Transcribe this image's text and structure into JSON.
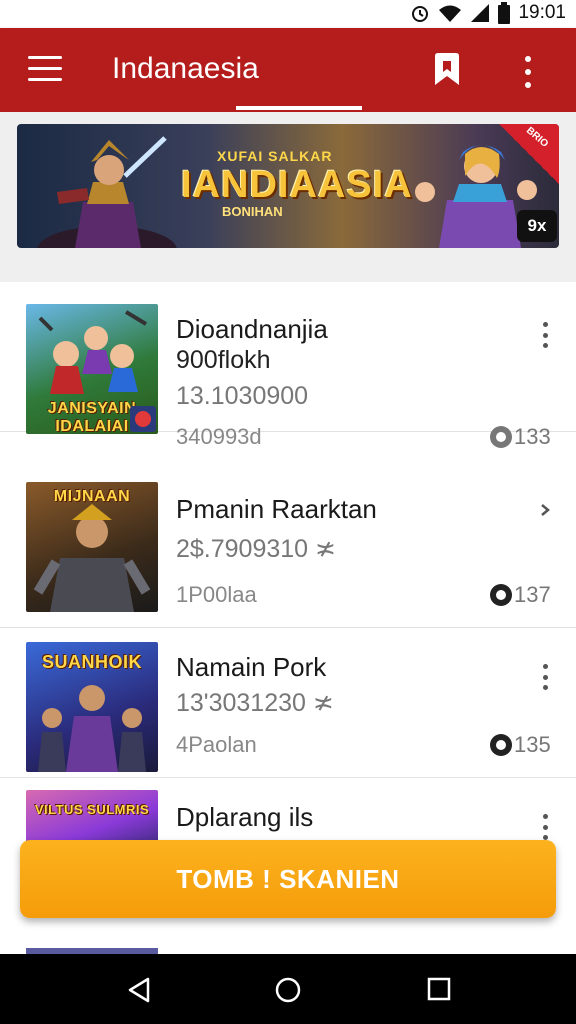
{
  "status_bar": {
    "time": "19:01"
  },
  "app_bar": {
    "title": "Indanaesia"
  },
  "banner": {
    "subtitle": "XUFAI SALKAR",
    "title": "IANDIAASIA",
    "caption": "BONIHAN",
    "ribbon": "BRIO",
    "close_label": "9x"
  },
  "list": {
    "items": [
      {
        "name": "Dioandnanjia",
        "subtitle": "900flokh",
        "value": "13.1030900",
        "meta": "340993d",
        "count": "133",
        "thumb_title": "JANISYAIN IDALAIAI"
      },
      {
        "name": "Pmanin Raarktan",
        "subtitle": "2$.7909310 ≭",
        "value": "",
        "meta": "1P00laa",
        "count": "137",
        "thumb_title": "MIJNAAN"
      },
      {
        "name": "Namain Pork",
        "subtitle": "13'3031230 ≭",
        "value": "",
        "meta": "4Paolan",
        "count": "135",
        "thumb_title": "SUANHOIK"
      },
      {
        "name": "Dplarang ils",
        "subtitle": "",
        "value": "",
        "meta": "",
        "count": "",
        "thumb_title": "VILTUS SULMRIS"
      }
    ]
  },
  "cta": {
    "label": "TOMB ! SKANIEN"
  },
  "colors": {
    "app_bar": "#b51c1c",
    "cta": "#f7a614",
    "nav": "#000000"
  }
}
